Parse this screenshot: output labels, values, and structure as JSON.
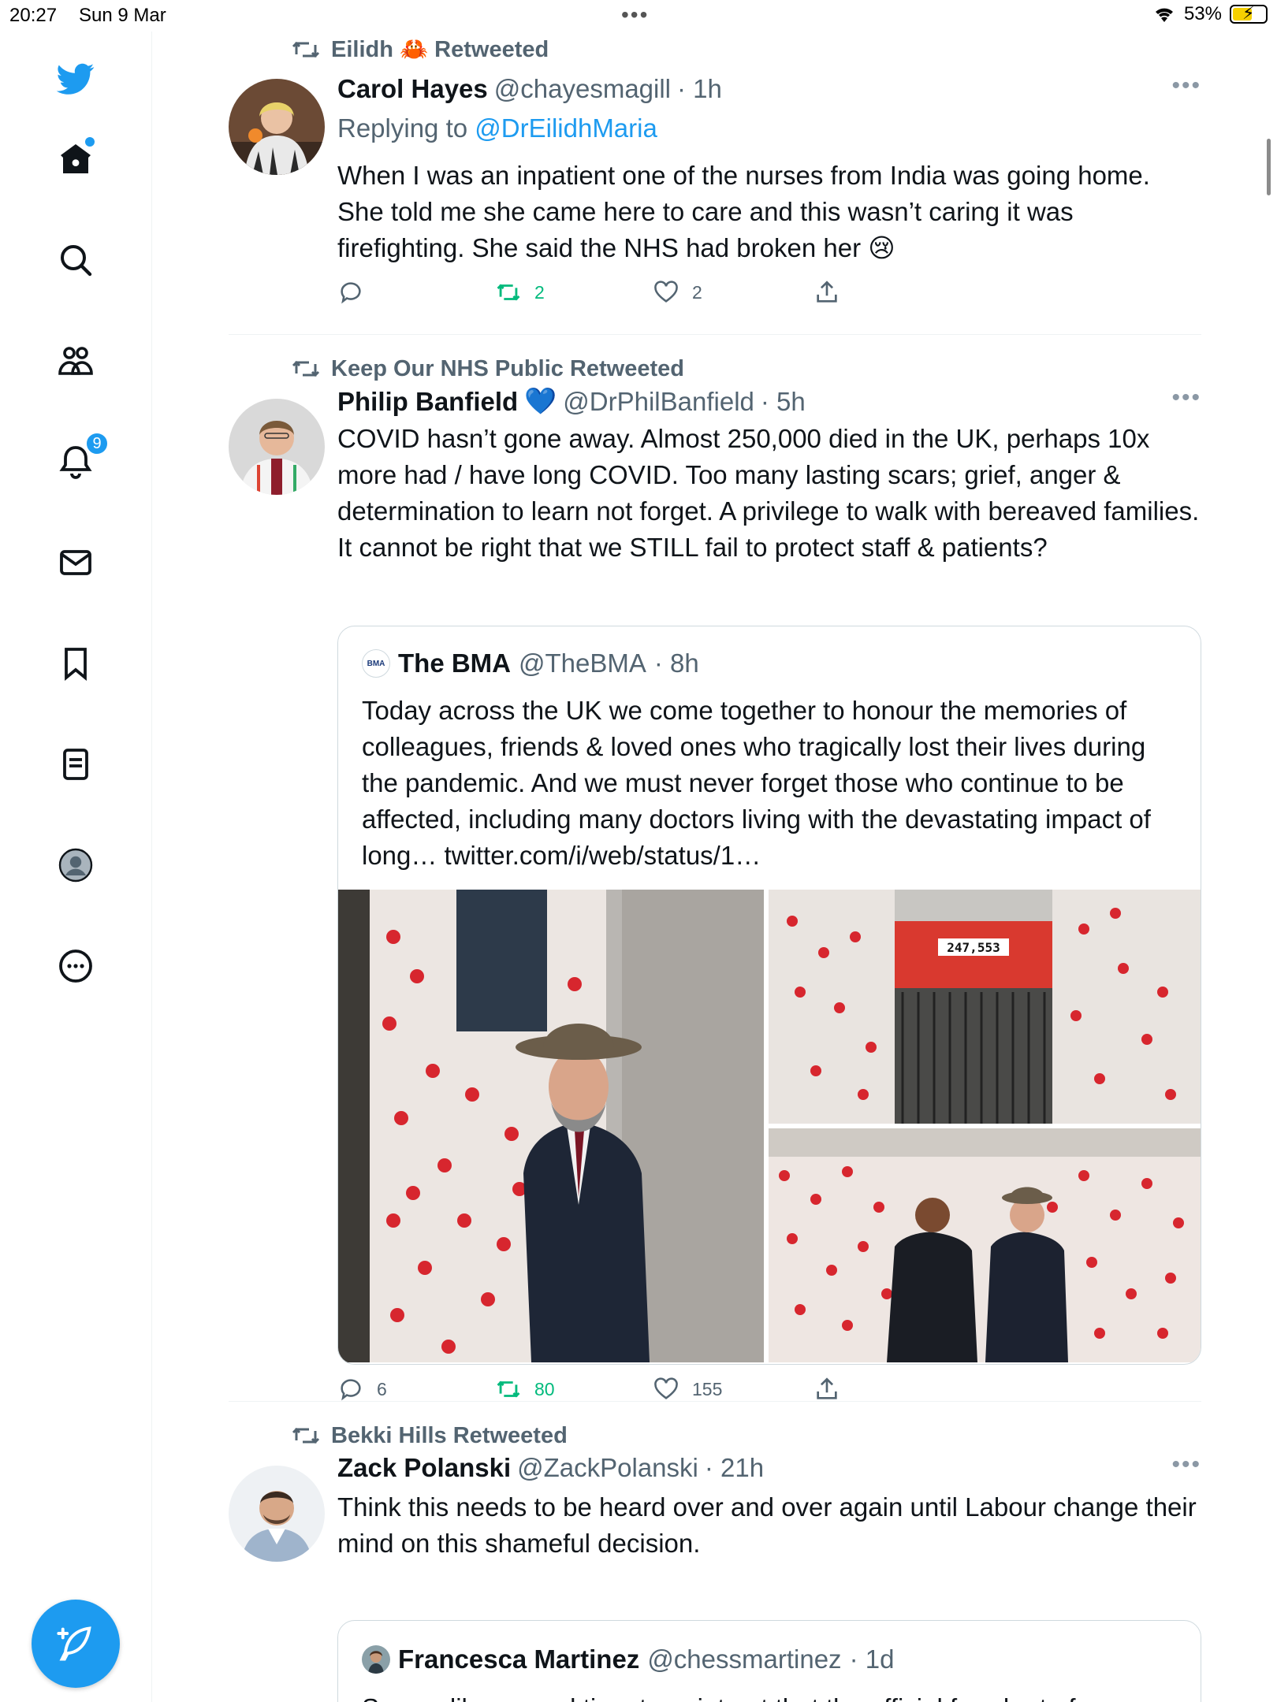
{
  "status_bar": {
    "time": "20:27",
    "date": "Sun 9 Mar",
    "battery": "53%"
  },
  "sidebar": {
    "items": [
      {
        "name": "home",
        "has_dot": true
      },
      {
        "name": "explore"
      },
      {
        "name": "communities"
      },
      {
        "name": "notifications",
        "badge": "9"
      },
      {
        "name": "messages"
      },
      {
        "name": "bookmarks"
      },
      {
        "name": "lists"
      },
      {
        "name": "profile"
      },
      {
        "name": "more"
      }
    ],
    "accent": "#1d9bf0"
  },
  "tweets": [
    {
      "retweeted_by": "Eilidh 🦀 Retweeted",
      "name": "Carol Hayes",
      "handle": "@chayesmagill",
      "time": "· 1h",
      "replying_prefix": "Replying to",
      "replying_to": "@DrEilidhMaria",
      "text": "When I was an inpatient one of the nurses from India was going home. She told me she came here to care and this wasn’t caring it was firefighting. She said the NHS had broken her 😢",
      "replies": "",
      "retweets": "2",
      "likes": "2"
    },
    {
      "retweeted_by": "Keep Our NHS Public Retweeted",
      "name": "Philip Banfield",
      "verified_emoji": "💙",
      "handle": "@DrPhilBanfield",
      "time": "· 5h",
      "text": "COVID hasn’t gone away.  Almost 250,000 died in the UK, perhaps 10x more had / have long COVID. Too many lasting scars; grief, anger & determination to learn not forget. A privilege to walk with bereaved families. It cannot be right that we STILL fail to protect staff & patients?",
      "quote": {
        "avatar_text": "BMA",
        "name": "The BMA",
        "handle": "@TheBMA",
        "time": "· 8h",
        "text": "Today across the UK we come together to honour the memories of colleagues, friends & loved ones who tragically lost their lives during the pandemic. And we must never forget those who continue to be affected, including many doctors living with the devastating impact of long… twitter.com/i/web/status/1…",
        "banner_number": "247,553"
      },
      "replies": "6",
      "retweets": "80",
      "likes": "155"
    },
    {
      "retweeted_by": "Bekki Hills Retweeted",
      "name": "Zack Polanski",
      "handle": "@ZackPolanski",
      "time": "· 21h",
      "text": "Think this needs to be heard over and over again until Labour change their mind on this shameful decision.",
      "quote": {
        "name": "Francesca Martinez",
        "handle": "@chessmartinez",
        "time": "· 1d",
        "text": "Seems like a good time to point out that the official fraud rate for"
      }
    }
  ]
}
